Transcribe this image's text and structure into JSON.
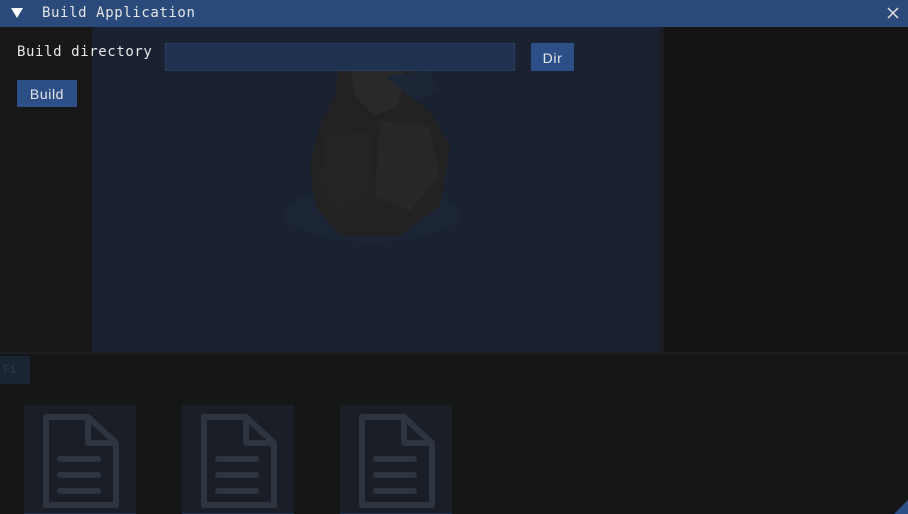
{
  "window": {
    "title": "Build Application"
  },
  "form": {
    "build_directory_label": "Build directory",
    "build_directory_value": "",
    "dir_button_label": "Dir",
    "build_button_label": "Build"
  },
  "background": {
    "tab_label": "Fi",
    "asset_icon": "document-icon"
  },
  "colors": {
    "title_bar": "#294a7a",
    "button": "#2b4f86",
    "input_bg": "#1f3250",
    "text": "#e8e8e8"
  }
}
